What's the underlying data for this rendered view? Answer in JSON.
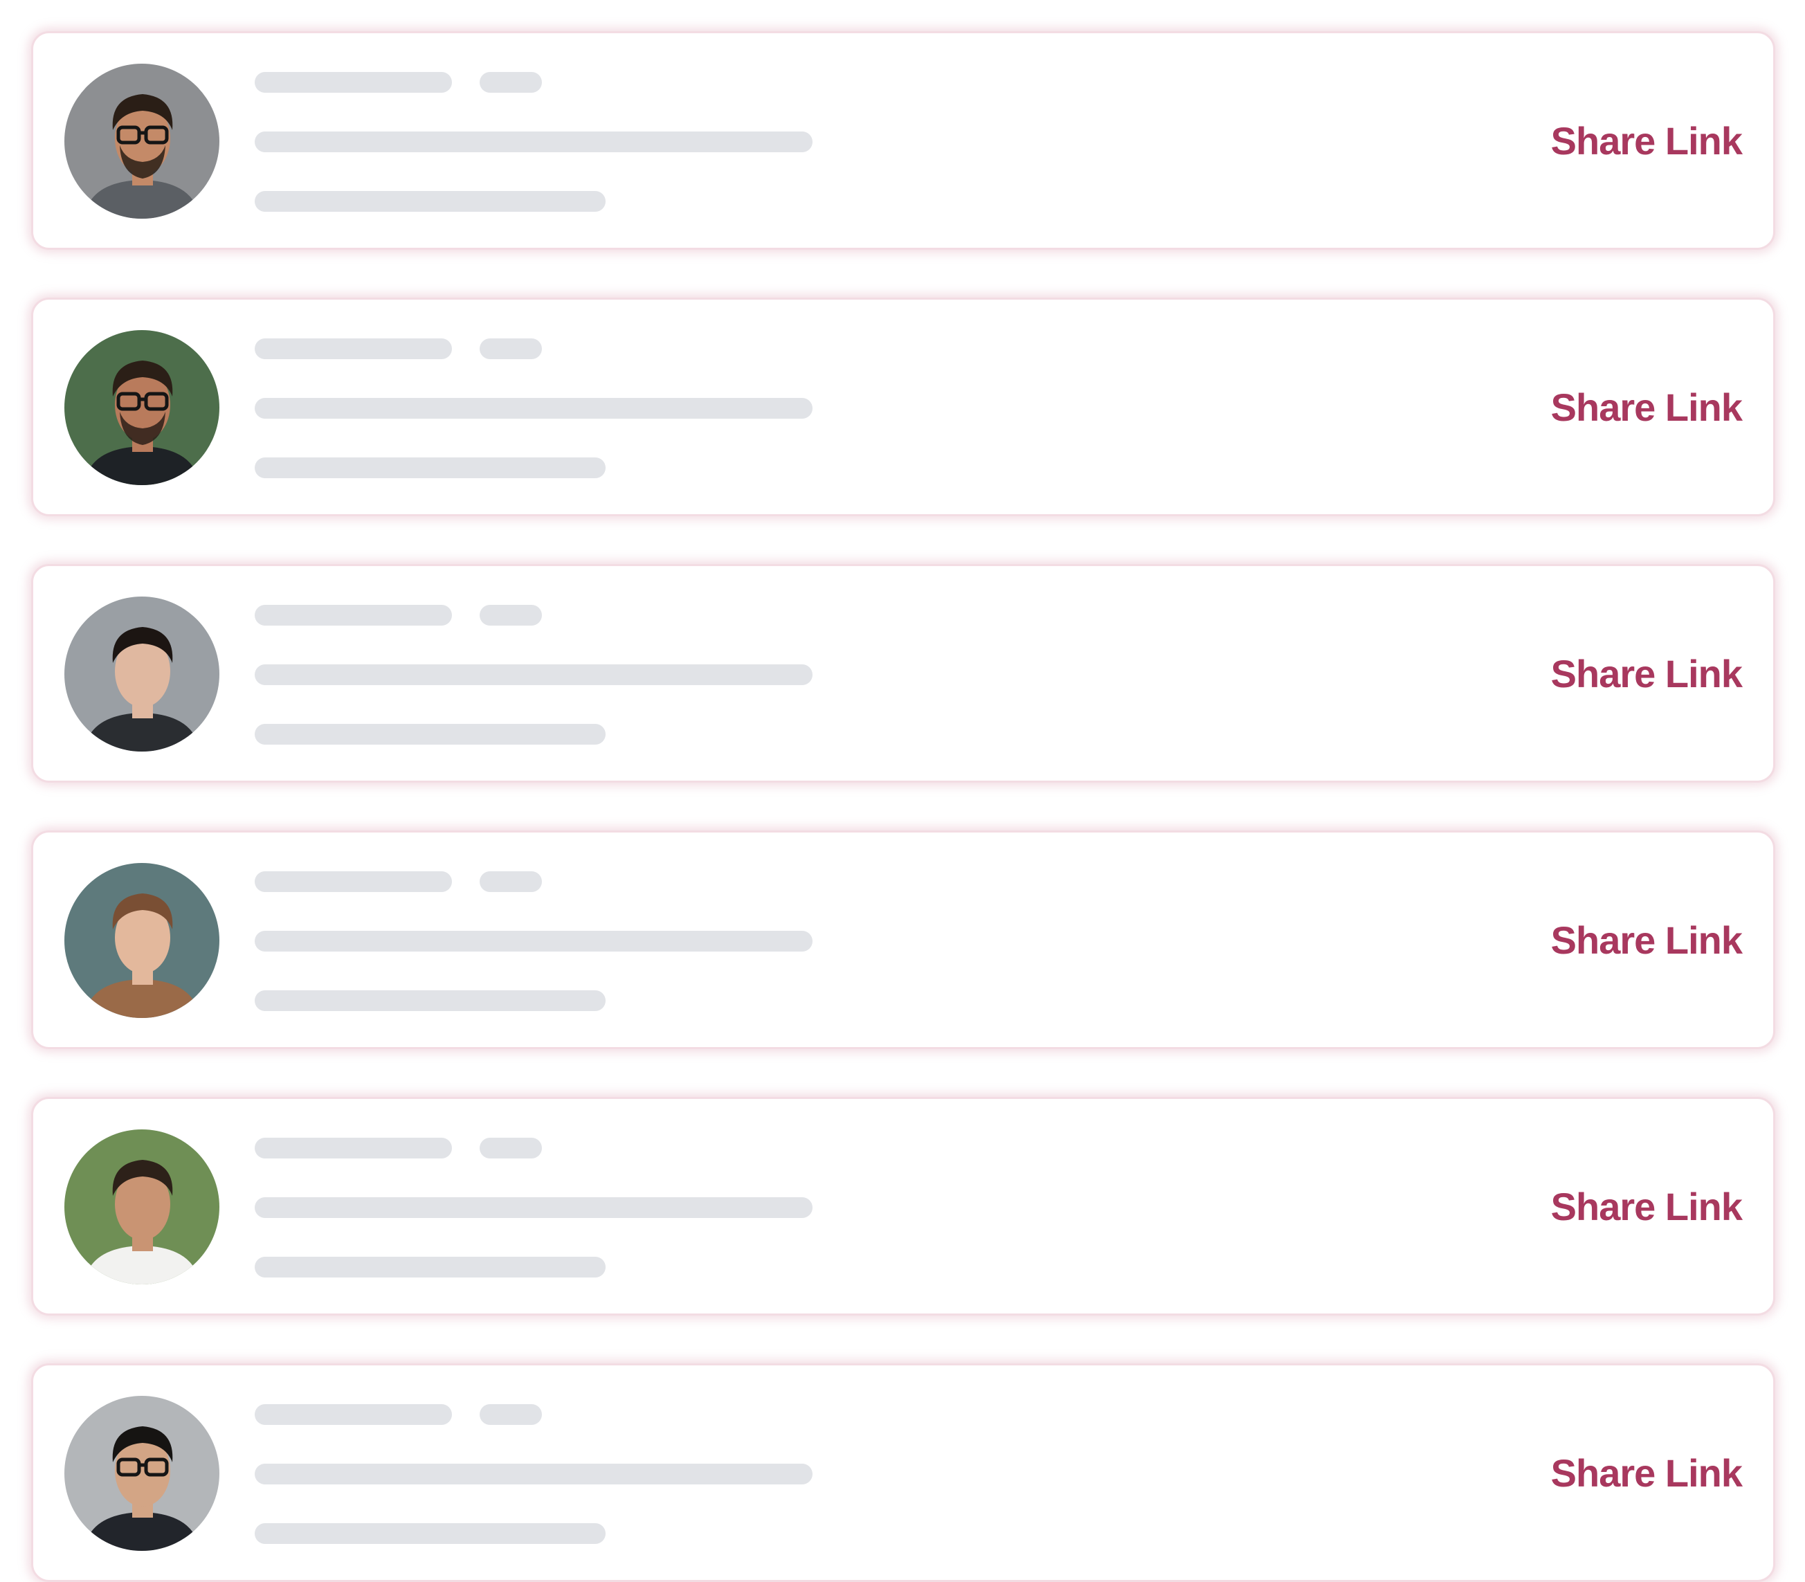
{
  "accent_color": "#a8385e",
  "skeleton_color": "#e1e3e7",
  "card_border_color": "#f3dce3",
  "cards": [
    {
      "share_label": "Share Link",
      "avatar": {
        "skin": "#c48a68",
        "hair": "#2a1e16",
        "bg": "#8d8f92",
        "shirt": "#5b5f64",
        "glasses": true,
        "beard": true
      }
    },
    {
      "share_label": "Share Link",
      "avatar": {
        "skin": "#b97b5c",
        "hair": "#2b1f17",
        "bg": "#4d6e4b",
        "shirt": "#1e2226",
        "glasses": true,
        "beard": true
      }
    },
    {
      "share_label": "Share Link",
      "avatar": {
        "skin": "#e0b8a0",
        "hair": "#1c1512",
        "bg": "#9a9fa4",
        "shirt": "#2a2d31",
        "glasses": false,
        "beard": false
      }
    },
    {
      "share_label": "Share Link",
      "avatar": {
        "skin": "#e3b89c",
        "hair": "#7a4f34",
        "bg": "#5e7a7c",
        "shirt": "#9a6a48",
        "glasses": false,
        "beard": false
      }
    },
    {
      "share_label": "Share Link",
      "avatar": {
        "skin": "#c99473",
        "hair": "#2d2119",
        "bg": "#6f8f55",
        "shirt": "#f2f2f0",
        "glasses": false,
        "beard": false
      }
    },
    {
      "share_label": "Share Link",
      "avatar": {
        "skin": "#d3a585",
        "hair": "#161412",
        "bg": "#b3b6b9",
        "shirt": "#22252b",
        "glasses": true,
        "beard": false
      }
    }
  ]
}
